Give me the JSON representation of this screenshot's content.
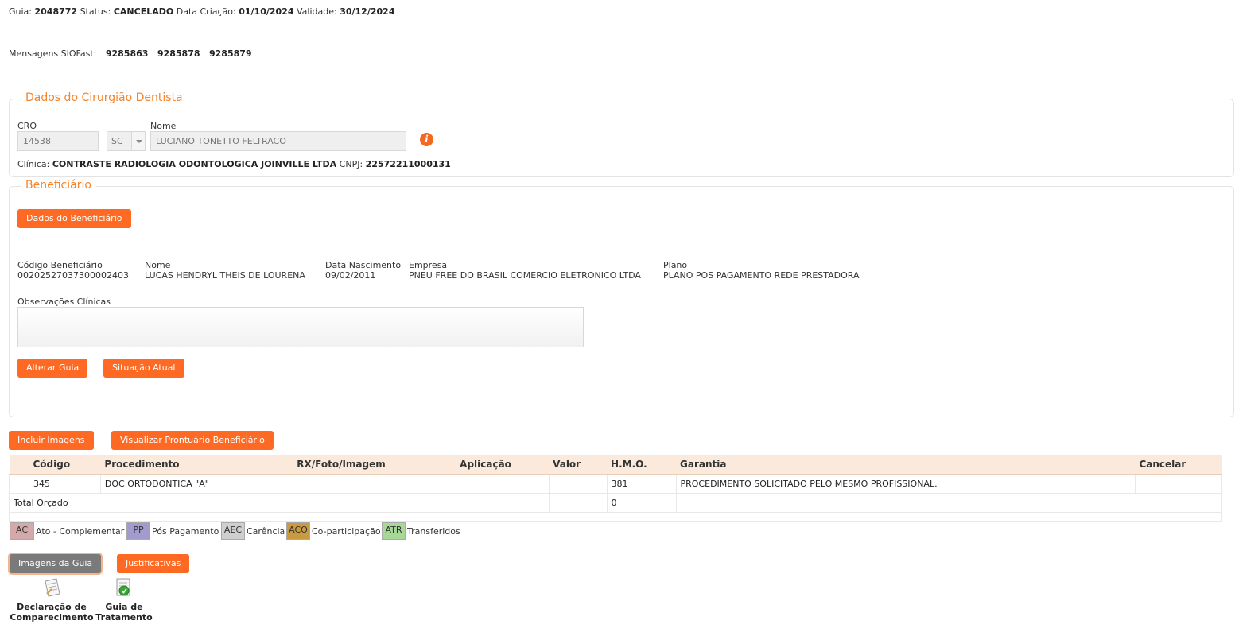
{
  "header": {
    "guia_label": "Guia:",
    "guia_value": "2048772",
    "status_label": "Status:",
    "status_value": "CANCELADO",
    "criacao_label": "Data Criação:",
    "criacao_value": "01/10/2024",
    "validade_label": "Validade:",
    "validade_value": "30/12/2024"
  },
  "mensagens": {
    "label": "Mensagens SIOFast:",
    "codes": [
      "9285863",
      "9285878",
      "9285879"
    ]
  },
  "dentista": {
    "title": "Dados do Cirurgião Dentista",
    "cro_label": "CRO",
    "cro_value": "14538",
    "uf_value": "SC",
    "nome_label": "Nome",
    "nome_value": "LUCIANO TONETTO FELTRACO",
    "clinica_label": "Clínica:",
    "clinica_value": "CONTRASTE RADIOLOGIA ODONTOLOGICA JOINVILLE LTDA",
    "cnpj_label": "CNPJ:",
    "cnpj_value": "22572211000131",
    "info_icon_glyph": "i"
  },
  "beneficiario": {
    "title": "Beneficiário",
    "dados_button": "Dados do Beneficiário",
    "codigo_label": "Código Beneficiário",
    "codigo_value": "00202527037300002403",
    "nome_label": "Nome",
    "nome_value": "LUCAS HENDRYL THEIS DE LOURENA",
    "nascimento_label": "Data Nascimento",
    "nascimento_value": "09/02/2011",
    "empresa_label": "Empresa",
    "empresa_value": "PNEU FREE DO BRASIL COMERCIO ELETRONICO LTDA",
    "plano_label": "Plano",
    "plano_value": "PLANO POS PAGAMENTO REDE PRESTADORA",
    "obs_label": "Observações Clínicas",
    "alterar_button": "Alterar Guia",
    "situacao_button": "Situação Atual"
  },
  "actions": {
    "incluir_imagens": "Incluir Imagens",
    "visualizar_prontuario": "Visualizar Prontuário Beneficiário"
  },
  "table": {
    "headers": [
      "",
      "Código",
      "Procedimento",
      "RX/Foto/Imagem",
      "Aplicação",
      "Valor",
      "H.M.O.",
      "Garantia",
      "Cancelar"
    ],
    "row": {
      "codigo": "345",
      "procedimento": "DOC ORTODONTICA \"A\"",
      "hmo": "381",
      "garantia": "PROCEDIMENTO SOLICITADO PELO MESMO PROFISSIONAL."
    },
    "total_label": "Total Orçado",
    "total_hmo": "0"
  },
  "legend": [
    {
      "code": "AC",
      "text": "Ato - Complementar",
      "color": "#d4a9a9"
    },
    {
      "code": "PP",
      "text": "Pós Pagamento",
      "color": "#a29bce"
    },
    {
      "code": "AEC",
      "text": "Carência",
      "color": "#cfcfcf"
    },
    {
      "code": "ACO",
      "text": "Co-participação",
      "color": "#c99a3f"
    },
    {
      "code": "ATR",
      "text": "Transferidos",
      "color": "#a8d898"
    }
  ],
  "bottom": {
    "imagens_guia": "Imagens da Guia",
    "justificativas": "Justificativas",
    "declaracao_line1": "Declaração de",
    "declaracao_line2": "Comparecimento",
    "guia_line1": "Guia de",
    "guia_line2": "Tratamento"
  }
}
